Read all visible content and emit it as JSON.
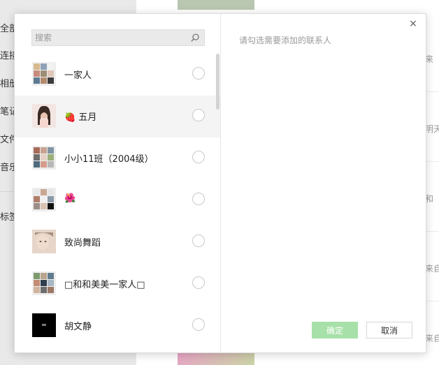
{
  "background": {
    "nav_items": [
      "全部",
      "连接",
      "相册",
      "笔记",
      "文件",
      "音乐",
      "标签"
    ],
    "side_texts": [
      "来",
      "明天",
      "和",
      "来自",
      "来自"
    ]
  },
  "dialog": {
    "search": {
      "placeholder": "搜索",
      "value": ""
    },
    "hint": "请勾选需要添加的联系人",
    "close_label": "×",
    "ok_label": "确定",
    "cancel_label": "取消",
    "contacts": [
      {
        "name": "一家人",
        "avatar": "group-collage",
        "selected": false
      },
      {
        "name": "🍓 五月",
        "avatar": "portrait-photo",
        "selected": true
      },
      {
        "name": "小小11班（2004级）",
        "avatar": "group-collage",
        "selected": false
      },
      {
        "name": "🌺",
        "avatar": "group-collage",
        "selected": false
      },
      {
        "name": "致尚舞蹈",
        "avatar": "portrait-photo",
        "selected": false
      },
      {
        "name": "□和和美美一家人□",
        "avatar": "group-collage",
        "selected": false
      },
      {
        "name": "胡文静",
        "avatar": "black-logo",
        "selected": false
      }
    ],
    "colors": {
      "accent_disabled": "#a7e0a9",
      "row_highlight": "#f4f4f4"
    }
  }
}
